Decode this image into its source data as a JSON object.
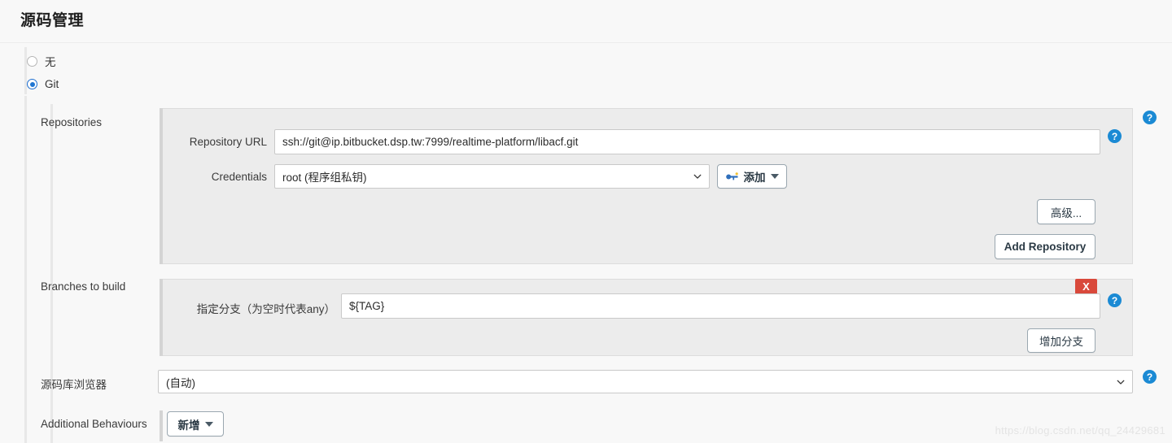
{
  "page": {
    "title": "源码管理"
  },
  "scm_options": [
    {
      "label": "无",
      "selected": false
    },
    {
      "label": "Git",
      "selected": true
    }
  ],
  "sections": {
    "repositories": {
      "label": "Repositories",
      "repository_url": {
        "label": "Repository URL",
        "value": "ssh://git@ip.bitbucket.dsp.tw:7999/realtime-platform/libacf.git"
      },
      "credentials": {
        "label": "Credentials",
        "value": "root (程序组私钥)"
      },
      "add_credentials_button": "添加",
      "advanced_button": "高级...",
      "add_repository_button": "Add Repository"
    },
    "branches": {
      "label": "Branches to build",
      "branch_specifier": {
        "label": "指定分支（为空时代表any）",
        "value": "${TAG}"
      },
      "delete_button": "X",
      "add_branch_button": "增加分支"
    },
    "repository_browser": {
      "label": "源码库浏览器",
      "value": "(自动)"
    },
    "additional_behaviours": {
      "label": "Additional Behaviours",
      "add_button": "新增"
    }
  },
  "help_icon": "?",
  "icons": {
    "key": "key-icon",
    "caret": "chevron-down-icon"
  },
  "colors": {
    "accent": "#1b8ad4",
    "radio_selected": "#1f76d2",
    "danger": "#d9493b",
    "panel_bg": "#ececec",
    "page_bg": "#f8f8f8"
  },
  "watermark": "https://blog.csdn.net/qq_24429681"
}
